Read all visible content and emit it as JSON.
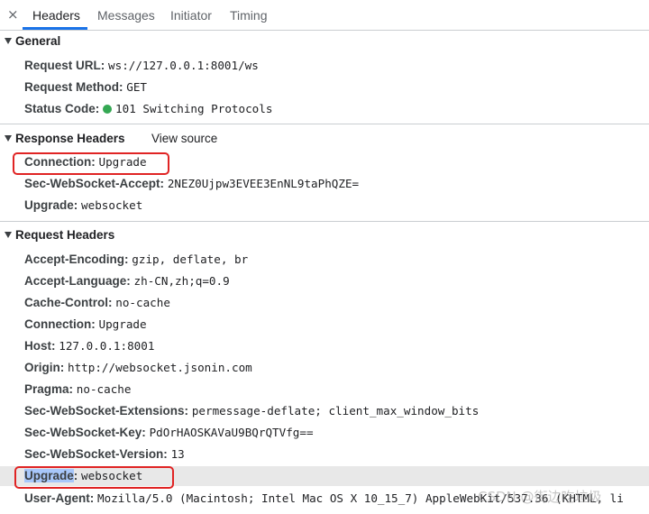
{
  "tabs": {
    "close": "×",
    "headers": "Headers",
    "messages": "Messages",
    "initiator": "Initiator",
    "timing": "Timing"
  },
  "general": {
    "title": "General",
    "request_url_key": "Request URL:",
    "request_url_val": "ws://127.0.0.1:8001/ws",
    "request_method_key": "Request Method:",
    "request_method_val": "GET",
    "status_code_key": "Status Code:",
    "status_code_val": "101 Switching Protocols",
    "status_color": "#34a853"
  },
  "response": {
    "title": "Response Headers",
    "view_source": "View source",
    "rows": [
      {
        "key": "Connection:",
        "val": "Upgrade"
      },
      {
        "key": "Sec-WebSocket-Accept:",
        "val": "2NEZ0Ujpw3EVEE3EnNL9taPhQZE="
      },
      {
        "key": "Upgrade:",
        "val": "websocket"
      }
    ]
  },
  "request": {
    "title": "Request Headers",
    "rows": [
      {
        "key": "Accept-Encoding:",
        "val": "gzip, deflate, br"
      },
      {
        "key": "Accept-Language:",
        "val": "zh-CN,zh;q=0.9"
      },
      {
        "key": "Cache-Control:",
        "val": "no-cache"
      },
      {
        "key": "Connection:",
        "val": "Upgrade"
      },
      {
        "key": "Host:",
        "val": "127.0.0.1:8001"
      },
      {
        "key": "Origin:",
        "val": "http://websocket.jsonin.com"
      },
      {
        "key": "Pragma:",
        "val": "no-cache"
      },
      {
        "key": "Sec-WebSocket-Extensions:",
        "val": "permessage-deflate; client_max_window_bits"
      },
      {
        "key": "Sec-WebSocket-Key:",
        "val": "PdOrHAOSKAVaU9BQrQTVfg=="
      },
      {
        "key": "Sec-WebSocket-Version:",
        "val": "13"
      },
      {
        "key": "Upgrade",
        "key_suffix": ":",
        "val": "websocket"
      },
      {
        "key": "User-Agent:",
        "val": "Mozilla/5.0 (Macintosh; Intel Mac OS X 10_15_7) AppleWebKit/537.36 (KHTML, li"
      }
    ]
  },
  "watermark": "CSDN @街边吃垃圾",
  "colors": {
    "accent": "#1a73e8",
    "highlight_box": "#e02424",
    "selected_row": "#e8e8e8"
  }
}
